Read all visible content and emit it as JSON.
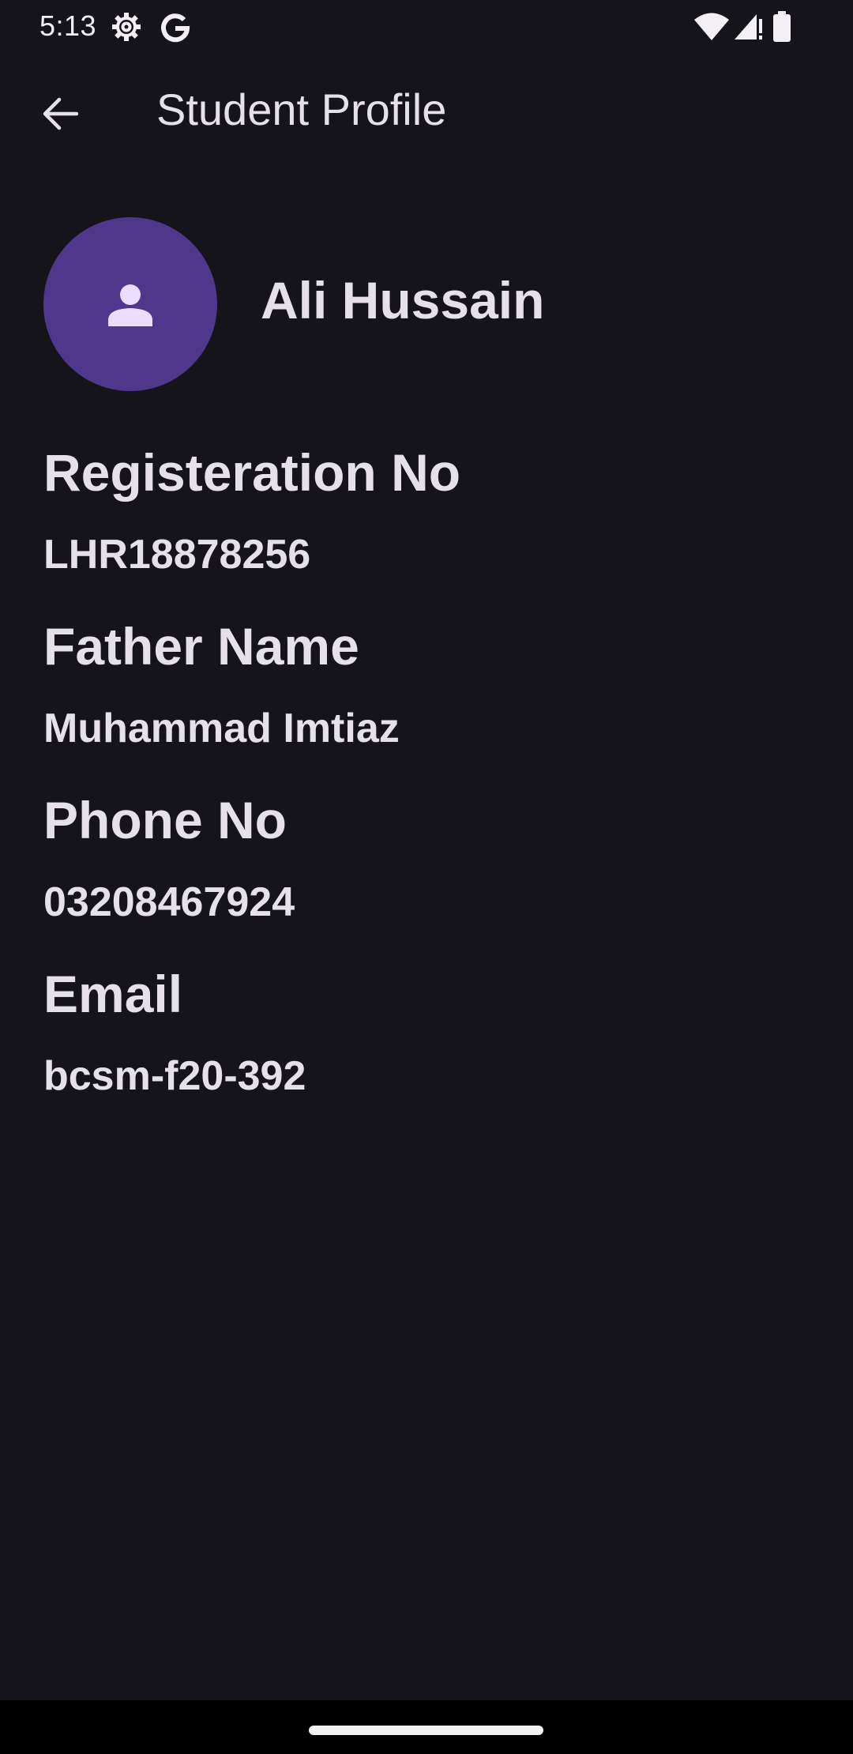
{
  "status_bar": {
    "time": "5:13",
    "icons": [
      "settings-gear-icon",
      "google-g-icon",
      "wifi-icon",
      "cell-signal-icon",
      "battery-icon"
    ]
  },
  "app_bar": {
    "back_icon": "arrow-back-icon",
    "title": "Student Profile"
  },
  "profile": {
    "avatar_icon": "person-icon",
    "name": "Ali Hussain",
    "fields": [
      {
        "label": "Registeration No",
        "value": "LHR18878256"
      },
      {
        "label": "Father Name",
        "value": "Muhammad Imtiaz"
      },
      {
        "label": "Phone No",
        "value": "03208467924"
      },
      {
        "label": "Email",
        "value": "bcsm-f20-392"
      }
    ]
  },
  "colors": {
    "background": "#16141b",
    "avatar_background": "#4f378b",
    "avatar_icon": "#eaddff",
    "text": "#e6e0e9"
  }
}
